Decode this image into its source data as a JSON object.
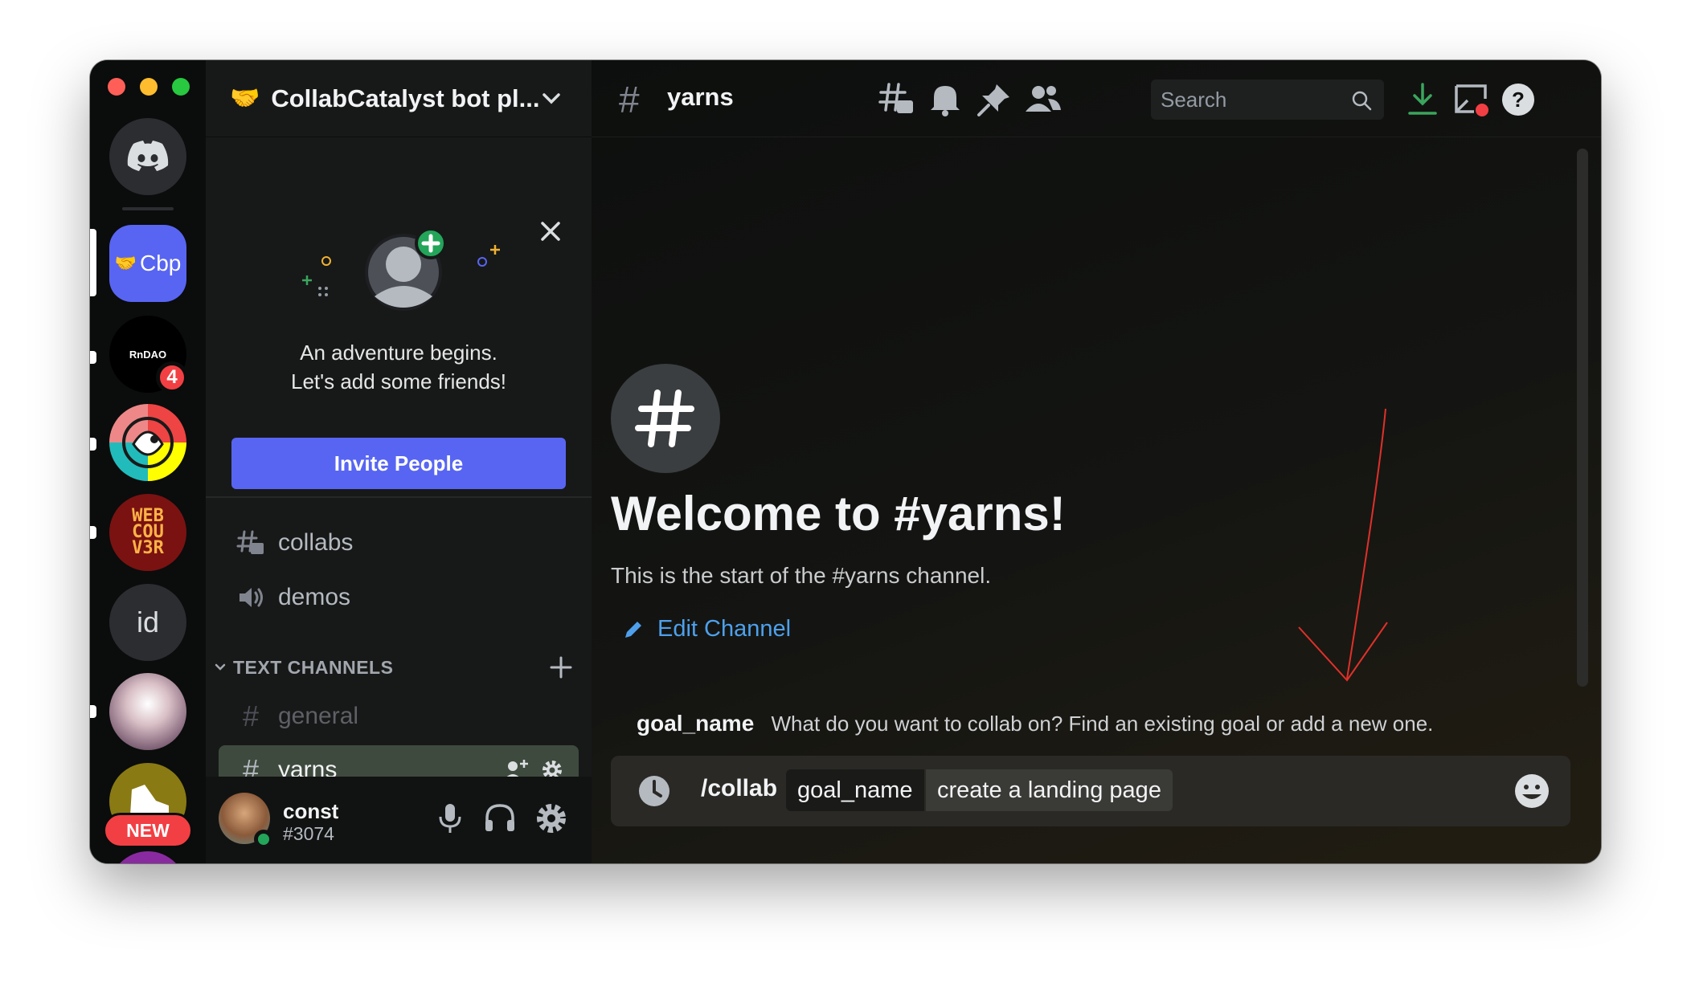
{
  "server_rail": {
    "active_server_label": "Cbp",
    "rndao_label": "RnDAO",
    "rndao_badge": "4",
    "web_label_lines": [
      "WEB",
      "COU",
      "V3R"
    ],
    "id_label": "id",
    "new_label": "NEW"
  },
  "guild": {
    "name": "CollabCatalyst bot pl...",
    "emoji": "🤝"
  },
  "onboarding": {
    "line1": "An adventure begins.",
    "line2": "Let's add some friends!",
    "invite_label": "Invite People"
  },
  "channels": {
    "collabs": "collabs",
    "demos": "demos",
    "category_label": "TEXT CHANNELS",
    "general": "general",
    "yarns": "yarns"
  },
  "user": {
    "name": "const",
    "tag": "#3074"
  },
  "topbar": {
    "channel_name": "yarns",
    "search_placeholder": "Search"
  },
  "welcome": {
    "title": "Welcome to #yarns!",
    "subtitle": "This is the start of the #yarns channel.",
    "edit_label": "Edit Channel"
  },
  "command_hint": {
    "option_name": "goal_name",
    "description": "What do you want to collab on? Find an existing goal or add a new one."
  },
  "composer": {
    "command": "/collab",
    "option_name": "goal_name",
    "option_value": "create a landing page"
  },
  "colors": {
    "blurple": "#5865f2",
    "link_blue": "#4ea0ec",
    "download_green": "#3ba55d",
    "notify_red": "#f23f43"
  }
}
